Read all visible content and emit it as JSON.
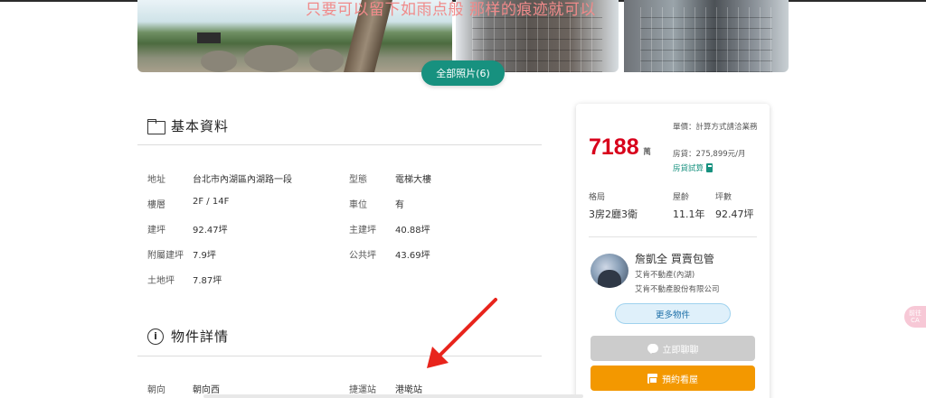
{
  "gallery": {
    "watermark_text": "只要可以留下如雨点般 那样的痕迹就可以",
    "all_photos_label": "全部照片(6)"
  },
  "basic_info": {
    "title": "基本資料",
    "rows": [
      {
        "label": "地址",
        "value": "台北市內湖區內湖路一段",
        "label2": "型態",
        "value2": "電梯大樓"
      },
      {
        "label": "樓層",
        "value": "2F / 14F",
        "label2": "車位",
        "value2": "有"
      },
      {
        "label": "建坪",
        "value": "92.47坪",
        "label2": "主建坪",
        "value2": "40.88坪"
      },
      {
        "label": "附屬建坪",
        "value": "7.9坪",
        "label2": "公共坪",
        "value2": "43.69坪"
      },
      {
        "label": "土地坪",
        "value": "7.87坪",
        "label2": "",
        "value2": ""
      }
    ]
  },
  "property_details": {
    "title": "物件詳情",
    "rows": [
      {
        "label": "朝向",
        "value": "朝向西",
        "label2": "捷運站",
        "value2": "港墘站"
      }
    ]
  },
  "card": {
    "price": "7188",
    "price_unit": "萬",
    "unit_price": "單價：計算方式請洽業務",
    "loan": "房貸：275,899元/月",
    "loan_calc": "房貸試算",
    "specs": [
      {
        "label": "格局",
        "value": "3房2廳3衛"
      },
      {
        "label": "屋齡",
        "value": "11.1年"
      },
      {
        "label": "坪數",
        "value": "92.47坪"
      }
    ],
    "agent": {
      "name": "詹凱全 買賣包管",
      "branch": "艾肯不動產(內湖)",
      "company": "艾肯不動產股份有限公司"
    },
    "more_listings": "更多物件",
    "chat_now": "立即聊聊",
    "book_viewing": "預約看屋"
  },
  "side_badge": "前往\nCA",
  "colors": {
    "accent": "#17917f",
    "price_red": "#d8001b",
    "orange": "#f39800",
    "arrow_red": "#e8241c"
  }
}
